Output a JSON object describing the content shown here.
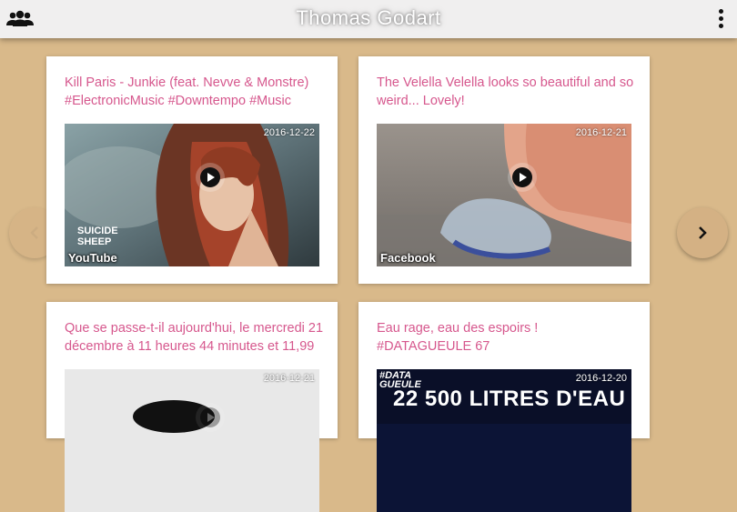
{
  "header": {
    "title": "Thomas Godart",
    "left_icon": "people-icon",
    "right_icon": "more-vert-icon"
  },
  "navigation": {
    "prev_icon": "chevron-left-icon",
    "next_icon": "chevron-right-icon"
  },
  "cards": [
    {
      "title": "Kill Paris - Junkie (feat. Nevve & Monstre) #ElectronicMusic #Downtempo #Music",
      "date": "2016-12-22",
      "source": "YouTube",
      "watermark": "SUICIDE SHEEP"
    },
    {
      "title": "The Velella Velella looks so beautiful and so weird... Lovely!",
      "date": "2016-12-21",
      "source": "Facebook"
    },
    {
      "title": "Que se passe-t-il aujourd'hui, le mercredi 21 décembre à 11 heures 44 minutes et 11,99",
      "date": "2016-12-21"
    },
    {
      "title": "Eau rage, eau des espoirs ! #DATAGUEULE 67",
      "date": "2016-12-20",
      "thumb_logo": "#DATA GUEULE",
      "thumb_headline": "22 500 LITRES D'EAU"
    }
  ],
  "colors": {
    "background": "#d9b98a",
    "topbar": "#f0efef",
    "title_pink": "#d6578d",
    "card": "#ffffff"
  }
}
